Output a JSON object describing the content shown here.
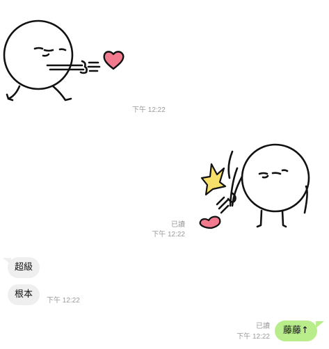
{
  "messages": [
    {
      "type": "sticker",
      "direction": "incoming",
      "sticker_name": "round-character-throwing-heart",
      "time": "下午 12:22"
    },
    {
      "type": "sticker",
      "direction": "outgoing",
      "sticker_name": "round-character-slapping-heart-away",
      "read": "已讀",
      "time": "下午 12:22"
    },
    {
      "type": "text",
      "direction": "incoming",
      "text": "超級"
    },
    {
      "type": "text",
      "direction": "incoming",
      "text": "根本",
      "time": "下午 12:22"
    },
    {
      "type": "text",
      "direction": "outgoing",
      "text": "藤藤↑",
      "read": "已讀",
      "time": "下午 12:22"
    }
  ],
  "colors": {
    "incoming_bubble": "#efefef",
    "outgoing_bubble": "#b9ed8b",
    "heart": "#f27a8e",
    "spark": "#f7e06a",
    "meta_text": "#9a9a9a"
  }
}
